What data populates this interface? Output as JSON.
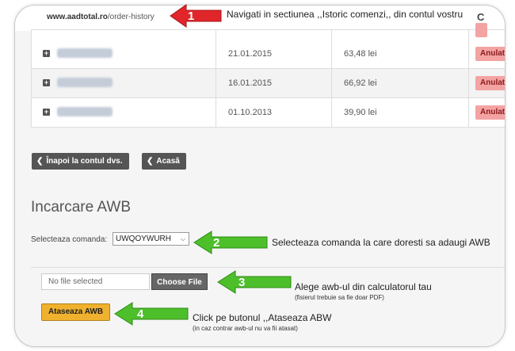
{
  "browser": {
    "url_domain": "www.aadtotal.ro",
    "url_path": "/order-history",
    "reload_icon": "reload-icon"
  },
  "orders_table": {
    "rows": [
      {
        "date": "21.01.2015",
        "total": "63,48 lei",
        "status": "Anulat"
      },
      {
        "date": "16.01.2015",
        "total": "66,92 lei",
        "status": "Anulat"
      },
      {
        "date": "01.10.2013",
        "total": "39,90 lei",
        "status": "Anulat"
      }
    ]
  },
  "nav": {
    "back_account_label": "Înapoi la contul dvs.",
    "home_label": "Acasă"
  },
  "awb": {
    "heading": "Incarcare AWB",
    "select_label": "Selecteaza comanda:",
    "select_value": "UWQOYWURH",
    "file_placeholder": "No file selected",
    "choose_file_label": "Choose File",
    "attach_label": "Ataseaza AWB"
  },
  "annotations": {
    "a1": {
      "number": "1",
      "text": "Navigati in sectiunea ,,Istoric comenzi,, din contul vostru"
    },
    "a2": {
      "number": "2",
      "text": "Selecteaza comanda la care doresti sa adaugi AWB"
    },
    "a3": {
      "number": "3",
      "text": "Alege awb-ul din calculatorul tau",
      "subtext": "(fisierul trebuie sa fie doar PDF)"
    },
    "a4": {
      "number": "4",
      "text": "Click pe butonul ,,Ataseaza ABW",
      "subtext": "(in caz contrar awb-ul nu va fii atasat)"
    }
  },
  "colors": {
    "red_arrow": "#e0262b",
    "green_arrow": "#4dbf2a",
    "status_badge": "#f4a3a3",
    "attach_button": "#f0b22e"
  }
}
